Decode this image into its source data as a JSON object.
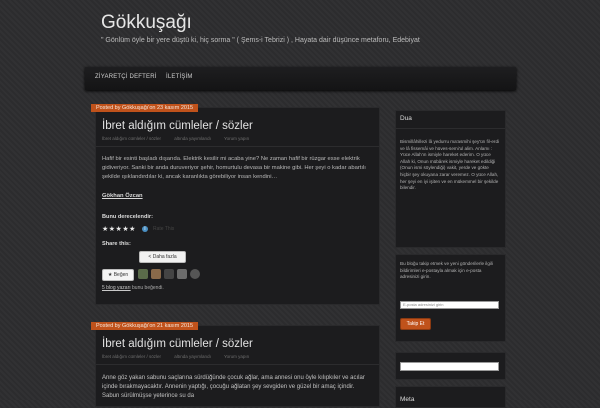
{
  "site": {
    "title": "Gökkuşağı",
    "description": "\" Gönlüm öyle bir yere düştü ki, hiç sorma \" ( Şems-i Tebrizi ) , Hayata dair düşünce metaforu, Edebiyat"
  },
  "nav": {
    "items": [
      "ZİYARETÇİ DEFTERİ",
      "İLETİŞİM"
    ]
  },
  "posts": [
    {
      "date": "Posted by   Gökkuşağı'on  23 kasım 2015",
      "title": "İbret aldığım cümleler / sözler",
      "meta": [
        "İbret aldığım cümleler / sözler",
        "altında yayımlandı",
        "Yorum yapın"
      ],
      "excerpt": "Hafif bir esinti başladı dışarıda. Elektrik kesilir mi acaba yine? Ne zaman hafif bir rüzgar esse elektrik gidiveriyor. Sanki bir anda duruveriyor şehir, homurtulu devasa bir makine gibi. Her şeyi o kadar abartılı şekilde ışıklandırdılar ki, ancak karanlıkta görebiliyor insan kendini…",
      "author": "Gökhan Özcan",
      "rate_label": "Bunu derecelendir:",
      "stars": "★★★★★",
      "info_icon": "i",
      "vote_text": "Rate This",
      "share_label": "Share this:",
      "share_button": "Daha fazla",
      "like_button": "★ Beğen",
      "likes_link": "5 blog yazarı",
      "likes_suffix": " bunu beğendi."
    },
    {
      "date": "Posted by   Gökkuşağı'on  21 kasım 2015",
      "title": "İbret aldığım cümleler / sözler",
      "meta": [
        "İbret aldığım cümleler / sözler",
        "altında yayımlandı",
        "Yorum yapın"
      ],
      "excerpt": "Anne göz yakan sabunu saçlarına sürdüğünde çocuk ağlar, ama annesi onu öyle kılıpkıler ve acılar içinde bırakmayacaktır. Annenin yaptığı, çocuğu ağlatan şey sevgiden ve güzel bir amaç içindir. Sabun sürülmüşse yeterince su da"
    }
  ],
  "sidebar": {
    "dua": {
      "title": "Dua",
      "text": "Bismillâhillezi lâ yedurru ma'asmihi şey'ün fil-erdi ve lâ fissemâi ve hüves-semi'ul alim. Anlamı : Yüce Allah'ın ismiyle hareket ederim. O yüce Allah ki, Onun mübârek ismiyle hareket edildiği (Onun ismi söylendiği) vakit, yerde ve gökte hiçbir şey okuyana zarar veremez. O yüce Allah, her şeyi en iyi işiten ve en mükemmel bir şekilde bilendir."
    },
    "follow": {
      "text": "Bu bloğu takip etmek ve yeni gönderilerle ilgili bildirimleri e-postayla almak için e-posta adresinizi girin.",
      "placeholder": "E-posta adresinizi girin",
      "button": "Takip Et"
    },
    "meta": {
      "title": "Meta"
    }
  },
  "colors": {
    "accent": "#c0521b",
    "background": "#2c2c2e",
    "panel": "#1c1c1e"
  }
}
